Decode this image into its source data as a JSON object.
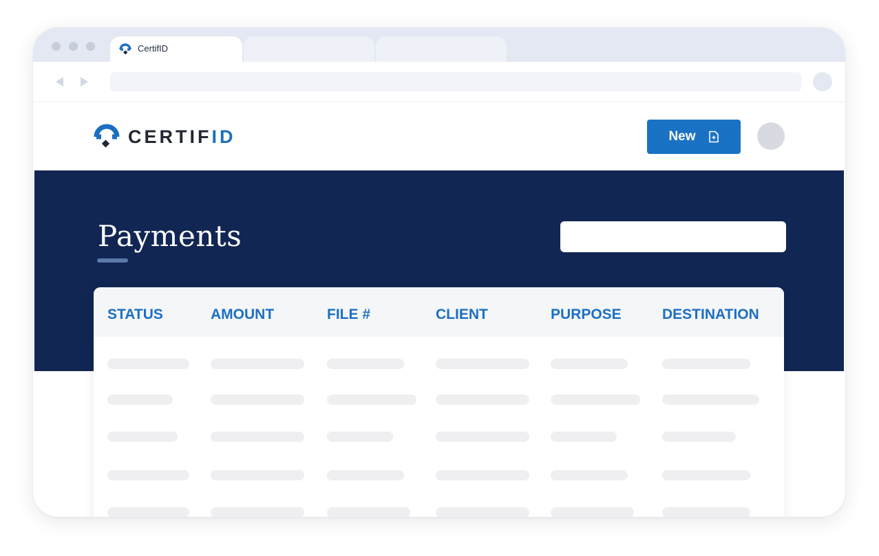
{
  "browser": {
    "tabs": [
      {
        "label": "CertifID",
        "active": true
      },
      {
        "label": "",
        "active": false
      },
      {
        "label": "",
        "active": false
      }
    ],
    "window_dots": [
      "dot",
      "dot",
      "dot"
    ],
    "nav_icons": [
      "back-arrow-icon",
      "forward-arrow-icon"
    ]
  },
  "header": {
    "logo_text_main": "CERTIF",
    "logo_text_accent": "ID",
    "new_button_label": "New",
    "new_button_icon": "new-document-icon"
  },
  "banner": {
    "title": "Payments",
    "search_placeholder": ""
  },
  "table": {
    "columns": [
      "STATUS",
      "AMOUNT",
      "FILE #",
      "CLIENT",
      "PURPOSE",
      "DESTINATION"
    ],
    "loading_rows": 5
  },
  "colors": {
    "brand_blue": "#1a72c4",
    "banner_navy": "#112653",
    "header_text": "#1b6fc3",
    "skeleton": "#efeff1"
  }
}
